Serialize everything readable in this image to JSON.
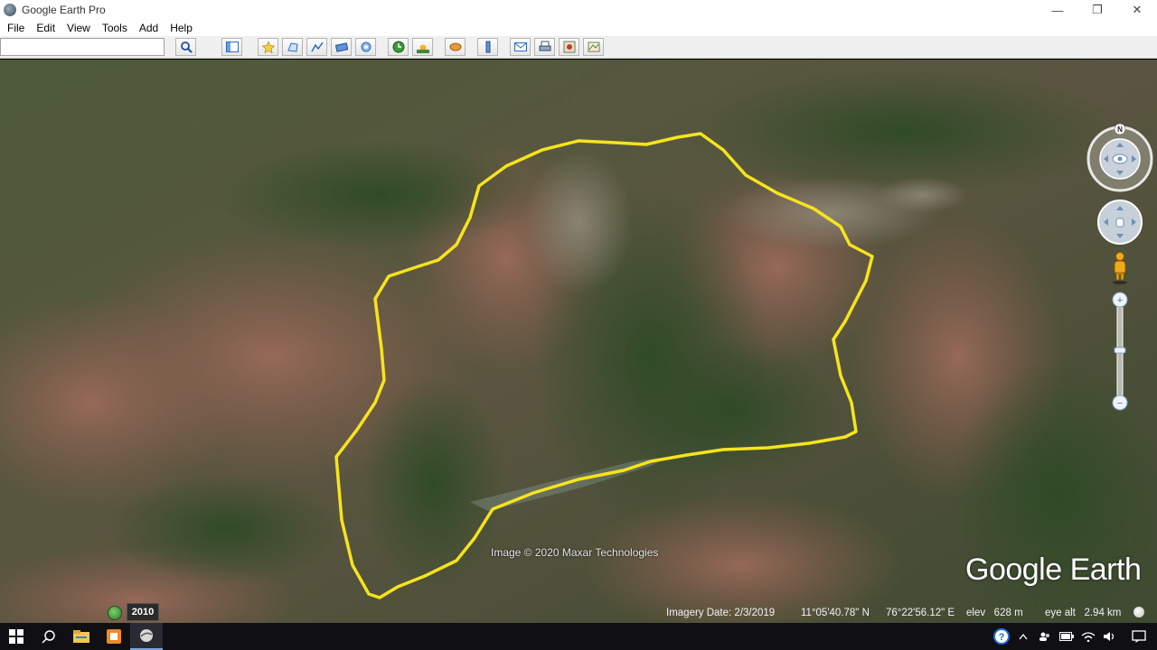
{
  "window": {
    "title": "Google Earth Pro",
    "minimize_glyph": "—",
    "restore_glyph": "❐",
    "close_glyph": "✕"
  },
  "menu": {
    "items": [
      "File",
      "Edit",
      "View",
      "Tools",
      "Add",
      "Help"
    ]
  },
  "search": {
    "value": "",
    "placeholder": ""
  },
  "toolbar": {
    "icons": [
      "search-icon",
      "sidebar-toggle-icon",
      "add-placemark-icon",
      "add-polygon-icon",
      "add-path-icon",
      "add-image-overlay-icon",
      "record-tour-icon",
      "historical-imagery-icon",
      "sunlight-icon",
      "switch-planet-icon",
      "ruler-icon",
      "email-icon",
      "print-icon",
      "save-image-icon",
      "view-in-maps-icon"
    ]
  },
  "map": {
    "attribution": "Image © 2020 Maxar Technologies",
    "brand": "Google Earth",
    "year_badge": "2010",
    "status": {
      "imagery_date": "Imagery Date: 2/3/2019",
      "latitude": "11°05'40.78\" N",
      "longitude": "76°22'56.12\" E",
      "elevation": "elev   628 m",
      "eye_alt": "eye alt   2.94 km"
    },
    "compass_north": "N",
    "path_color": "#f6e41c"
  },
  "nav": {
    "zoom_in": "+",
    "zoom_out": "−"
  },
  "taskbar": {
    "apps": [
      "windows-start-icon",
      "search-icon",
      "file-explorer-icon",
      "app-orange-icon",
      "google-earth-icon"
    ],
    "tray": [
      "help-icon",
      "chevron-up-icon",
      "people-icon",
      "battery-icon",
      "wifi-icon",
      "volume-icon",
      "notification-icon"
    ]
  }
}
